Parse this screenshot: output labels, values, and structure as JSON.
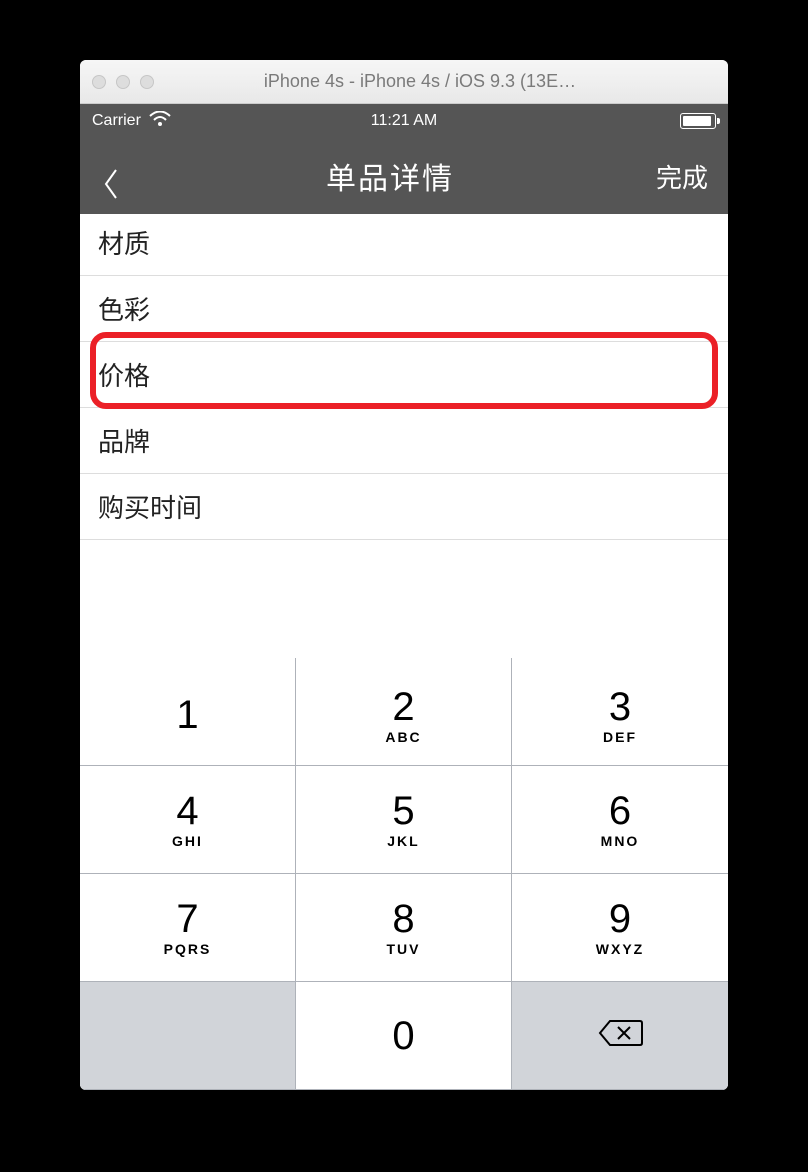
{
  "window": {
    "title": "iPhone 4s - iPhone 4s / iOS 9.3 (13E…"
  },
  "statusbar": {
    "carrier": "Carrier",
    "time": "11:21 AM"
  },
  "navbar": {
    "title": "单品详情",
    "done": "完成"
  },
  "form": {
    "material": "材质",
    "color": "色彩",
    "price": "价格",
    "brand": "品牌",
    "purchase_time": "购买时间"
  },
  "keypad": {
    "k1": {
      "n": "1",
      "l": ""
    },
    "k2": {
      "n": "2",
      "l": "ABC"
    },
    "k3": {
      "n": "3",
      "l": "DEF"
    },
    "k4": {
      "n": "4",
      "l": "GHI"
    },
    "k5": {
      "n": "5",
      "l": "JKL"
    },
    "k6": {
      "n": "6",
      "l": "MNO"
    },
    "k7": {
      "n": "7",
      "l": "PQRS"
    },
    "k8": {
      "n": "8",
      "l": "TUV"
    },
    "k9": {
      "n": "9",
      "l": "WXYZ"
    },
    "k0": {
      "n": "0",
      "l": ""
    }
  }
}
